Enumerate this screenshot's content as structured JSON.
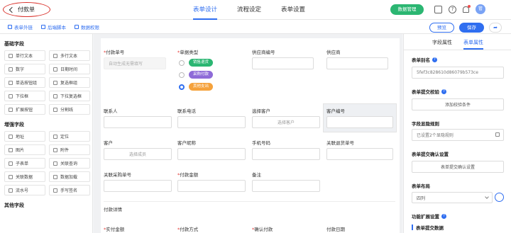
{
  "header": {
    "back_label": "付款单",
    "tabs": [
      "表单设计",
      "流程设定",
      "表单设置"
    ],
    "data_mgmt": "数据管理",
    "avatar_text": "管"
  },
  "toolbar": {
    "links": [
      "表单外链",
      "后端脚本",
      "数据权限"
    ],
    "preview": "预览",
    "save": "保存"
  },
  "left_panel": {
    "basic_title": "基础字段",
    "basic_fields": [
      "单行文本",
      "多行文本",
      "数字",
      "日期时间",
      "单选按钮组",
      "复选框组",
      "下拉框",
      "下拉复选框",
      "扩展按钮",
      "分割线"
    ],
    "enhanced_title": "增强字段",
    "enhanced_fields": [
      "地址",
      "定位",
      "图片",
      "附件",
      "子表单",
      "关联查询",
      "关联数据",
      "数据加载",
      "流水号",
      "手写签名"
    ],
    "more_title": "其他字段"
  },
  "form": {
    "r1": {
      "payment_no_label": "付款单号",
      "payment_no_placeholder": "自动生成无需填写",
      "doc_type_label": "单据类型",
      "doc_type_options": [
        "销售退货",
        "采购付款",
        "其他支出"
      ],
      "doc_type_colors": [
        "#2bb672",
        "#8e6bd8",
        "#f5a23c"
      ],
      "supplier_no_label": "供应商编号",
      "supplier_label": "供应商"
    },
    "r2": {
      "contact_label": "联系人",
      "phone_label": "联系电话",
      "select_customer_label": "选择客户",
      "select_customer_placeholder": "选择客户",
      "customer_no_label": "客户编号"
    },
    "r3": {
      "customer_label": "客户",
      "customer_placeholder": "选择成员",
      "customer_nick_label": "客户昵称",
      "mobile_label": "手机号码",
      "return_no_label": "关联退货单号"
    },
    "r4": {
      "purchase_no_label": "关联采购单号",
      "amount_label": "付款金额",
      "remark_label": "备注"
    },
    "detail_section": "付款详情",
    "r5": {
      "actual_label": "实付金额",
      "method_label": "付款方式",
      "confirm_label": "确认付款",
      "date_label": "付款日期"
    }
  },
  "right_panel": {
    "tabs": [
      "字段属性",
      "表单属性"
    ],
    "alias_label": "表单别名",
    "alias_value": "5fef3c828610d86079b573ce",
    "submit_check_label": "表单提交校验",
    "add_rule_button": "添加校验条件",
    "hide_rule_label": "字段显隐规则",
    "hide_rule_value": "已设置2个显隐规则",
    "confirm_label": "表单提交确认设置",
    "confirm_button": "表单提交确认设置",
    "layout_label": "表单布局",
    "layout_value": "四列",
    "ext_label": "功能扩展设置",
    "ext_sub": "表单提交数据"
  }
}
